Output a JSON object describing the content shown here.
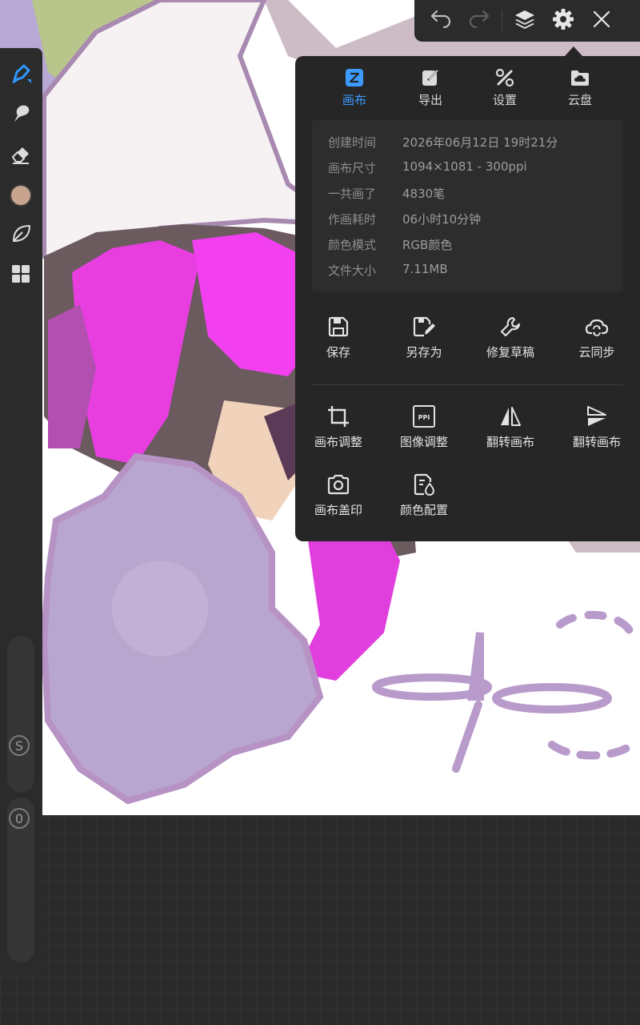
{
  "colors": {
    "accent": "#3b9bff",
    "current_brush_color": "#c8a48e",
    "panel_bg": "#262626",
    "toolbar_bg": "#2b2b2b"
  },
  "top_toolbar": {
    "icons": [
      "undo-icon",
      "redo-icon",
      "layers-icon",
      "settings-gear-icon",
      "close-icon"
    ]
  },
  "left_toolbar": {
    "tools": [
      "brush-icon",
      "smudge-icon",
      "eraser-icon",
      "color-swatch",
      "leaf-icon",
      "grid-menu-icon"
    ],
    "size_slider_label": "S",
    "opacity_slider_label": "0"
  },
  "settings_panel": {
    "tabs": [
      {
        "label": "画布",
        "icon": "canvas-icon",
        "active": true
      },
      {
        "label": "导出",
        "icon": "export-icon",
        "active": false
      },
      {
        "label": "设置",
        "icon": "tools-icon",
        "active": false
      },
      {
        "label": "云盘",
        "icon": "cloud-folder-icon",
        "active": false
      }
    ],
    "info": [
      {
        "key": "创建时间",
        "value": "2026年06月12日 19时21分"
      },
      {
        "key": "画布尺寸",
        "value": "1094×1081 - 300ppi"
      },
      {
        "key": "一共画了",
        "value": "4830笔"
      },
      {
        "key": "作画耗时",
        "value": "06小时10分钟"
      },
      {
        "key": "颜色模式",
        "value": "RGB颜色"
      },
      {
        "key": "文件大小",
        "value": "7.11MB"
      }
    ],
    "file_actions": [
      {
        "label": "保存",
        "icon": "save-icon"
      },
      {
        "label": "另存为",
        "icon": "save-as-icon"
      },
      {
        "label": "修复草稿",
        "icon": "wrench-icon"
      },
      {
        "label": "云同步",
        "icon": "cloud-sync-icon"
      }
    ],
    "canvas_actions": [
      {
        "label": "画布调整",
        "icon": "crop-icon"
      },
      {
        "label": "图像调整",
        "icon": "ppi-icon"
      },
      {
        "label": "翻转画布",
        "icon": "flip-horizontal-icon"
      },
      {
        "label": "翻转画布",
        "icon": "flip-vertical-icon"
      },
      {
        "label": "画布盖印",
        "icon": "camera-stamp-icon"
      },
      {
        "label": "颜色配置",
        "icon": "color-profile-icon"
      }
    ],
    "ppi_icon_text": "PPI"
  }
}
